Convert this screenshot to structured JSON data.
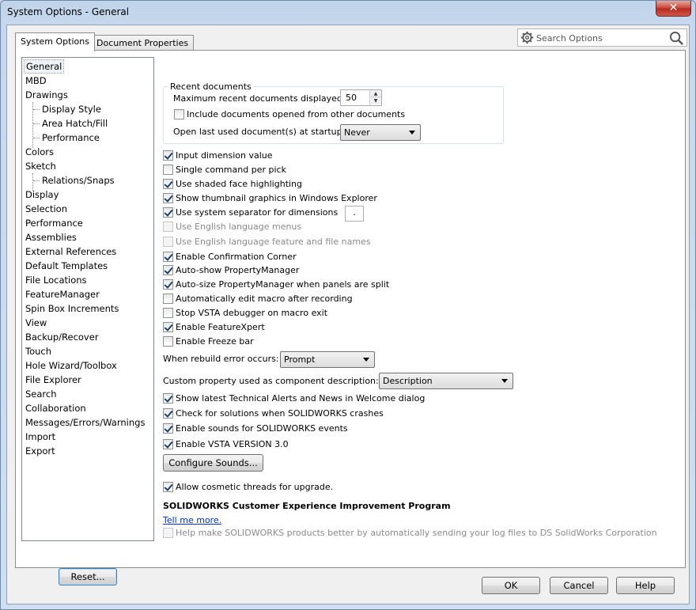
{
  "window": {
    "title": "System Options - General",
    "close_label": "✕"
  },
  "tabs": [
    {
      "label": "System Options",
      "active": true
    },
    {
      "label": "Document Properties",
      "active": false
    }
  ],
  "search": {
    "placeholder": "Search Options",
    "icon": "magnifier-icon"
  },
  "tree": {
    "items": [
      {
        "label": "General",
        "level": 0,
        "selected": true
      },
      {
        "label": "MBD",
        "level": 0
      },
      {
        "label": "Drawings",
        "level": 0
      },
      {
        "label": "Display Style",
        "level": 1
      },
      {
        "label": "Area Hatch/Fill",
        "level": 1
      },
      {
        "label": "Performance",
        "level": 1
      },
      {
        "label": "Colors",
        "level": 0
      },
      {
        "label": "Sketch",
        "level": 0
      },
      {
        "label": "Relations/Snaps",
        "level": 1
      },
      {
        "label": "Display",
        "level": 0
      },
      {
        "label": "Selection",
        "level": 0
      },
      {
        "label": "Performance",
        "level": 0
      },
      {
        "label": "Assemblies",
        "level": 0
      },
      {
        "label": "External References",
        "level": 0
      },
      {
        "label": "Default Templates",
        "level": 0
      },
      {
        "label": "File Locations",
        "level": 0
      },
      {
        "label": "FeatureManager",
        "level": 0
      },
      {
        "label": "Spin Box Increments",
        "level": 0
      },
      {
        "label": "View",
        "level": 0
      },
      {
        "label": "Backup/Recover",
        "level": 0
      },
      {
        "label": "Touch",
        "level": 0
      },
      {
        "label": "Hole Wizard/Toolbox",
        "level": 0
      },
      {
        "label": "File Explorer",
        "level": 0
      },
      {
        "label": "Search",
        "level": 0
      },
      {
        "label": "Collaboration",
        "level": 0
      },
      {
        "label": "Messages/Errors/Warnings",
        "level": 0
      },
      {
        "label": "Import",
        "level": 0
      },
      {
        "label": "Export",
        "level": 0
      }
    ],
    "reset_label": "Reset..."
  },
  "recent": {
    "group_title": "Recent documents",
    "max_label": "Maximum recent documents displayed:",
    "max_value": "50",
    "include_label": "Include documents opened from other documents",
    "include_checked": false,
    "open_last_label": "Open last used document(s) at startup:",
    "open_last_value": "Never"
  },
  "options": [
    {
      "label": "Input dimension value",
      "checked": true,
      "disabled": false
    },
    {
      "label": "Single command per pick",
      "checked": false,
      "disabled": false
    },
    {
      "label": "Use shaded face highlighting",
      "checked": true,
      "disabled": false
    },
    {
      "label": "Show thumbnail graphics in Windows Explorer",
      "checked": true,
      "disabled": false
    },
    {
      "label": "Use system separator for dimensions",
      "checked": true,
      "disabled": false,
      "separator": "."
    },
    {
      "label": "Use English language menus",
      "checked": false,
      "disabled": true
    },
    {
      "label": "Use English language feature and file names",
      "checked": false,
      "disabled": true
    },
    {
      "label": "Enable Confirmation Corner",
      "checked": true,
      "disabled": false
    },
    {
      "label": "Auto-show PropertyManager",
      "checked": true,
      "disabled": false
    },
    {
      "label": "Auto-size PropertyManager when panels are split",
      "checked": true,
      "disabled": false
    },
    {
      "label": "Automatically edit macro after recording",
      "checked": false,
      "disabled": false
    },
    {
      "label": "Stop VSTA debugger on macro exit",
      "checked": false,
      "disabled": false
    },
    {
      "label": "Enable FeatureXpert",
      "checked": true,
      "disabled": false
    },
    {
      "label": "Enable Freeze bar",
      "checked": false,
      "disabled": false
    }
  ],
  "rebuild": {
    "label": "When rebuild error occurs:",
    "value": "Prompt"
  },
  "custom_prop": {
    "label": "Custom property used as component description:",
    "value": "Description"
  },
  "options2": [
    {
      "label": "Show latest Technical Alerts and News in Welcome dialog",
      "checked": true
    },
    {
      "label": "Check for solutions when SOLIDWORKS crashes",
      "checked": true
    },
    {
      "label": "Enable sounds for SOLIDWORKS events",
      "checked": true
    },
    {
      "label": "Enable VSTA VERSION 3.0",
      "checked": true
    }
  ],
  "configure_sounds_label": "Configure Sounds...",
  "cosmetic": {
    "label": "Allow cosmetic threads for upgrade.",
    "checked": true
  },
  "ceip": {
    "title": "SOLIDWORKS Customer Experience Improvement Program",
    "link": "Tell me more.",
    "help_label": "Help make SOLIDWORKS products better by automatically sending your log files to DS SolidWorks Corporation",
    "help_checked": false
  },
  "footer": {
    "ok": "OK",
    "cancel": "Cancel",
    "help": "Help"
  }
}
